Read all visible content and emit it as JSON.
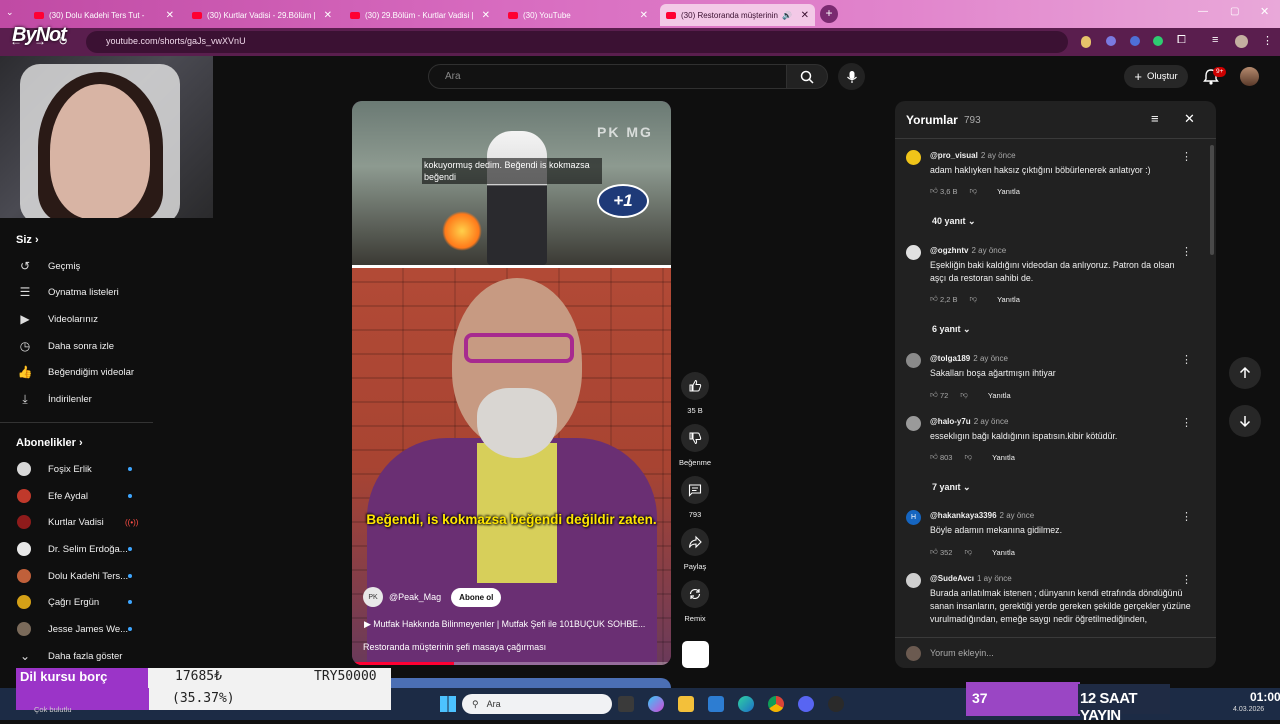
{
  "browser": {
    "tabs": [
      {
        "title": "(30) Dolu Kadehi Ters Tut -",
        "active": false
      },
      {
        "title": "(30) Kurtlar Vadisi - 29.Bölüm |",
        "active": false
      },
      {
        "title": "(30) 29.Bölüm - Kurtlar Vadisi |",
        "active": false
      },
      {
        "title": "(30) YouTube",
        "active": false
      },
      {
        "title": "(30) Restoranda müşterinin",
        "active": true
      }
    ],
    "url": "youtube.com/shorts/gaJs_vwXVnU"
  },
  "overlay": {
    "logo": "ByNot",
    "goal_label": "Dil kursu borç",
    "goal_amount": "17685₺",
    "goal_target": "TRY50000",
    "goal_percent": "(35.37%)",
    "goal_fraction": 0.3537,
    "weather": "Çok bulutlu",
    "stream_number": "37",
    "stream_label": "12 SAAT YAYIN",
    "clock": "01:00",
    "date": "4.03.2026"
  },
  "taskbar": {
    "search_placeholder": "Ara"
  },
  "sidebar": {
    "you_heading": "Siz",
    "items": [
      "Geçmiş",
      "Oynatma listeleri",
      "Videolarınız",
      "Daha sonra izle",
      "Beğendiğim videolar",
      "İndirilenler"
    ],
    "subs_heading": "Abonelikler",
    "subscriptions": [
      {
        "name": "Foşix Erlik",
        "color": "#d8d8d8"
      },
      {
        "name": "Efe Aydal",
        "color": "#c0392b"
      },
      {
        "name": "Kurtlar Vadisi",
        "color": "#8e1b1b"
      },
      {
        "name": "Dr. Selim Erdoğa...",
        "color": "#e8e8e8"
      },
      {
        "name": "Dolu Kadehi Ters...",
        "color": "#c0603a"
      },
      {
        "name": "Çağrı Ergün",
        "color": "#d4a017"
      },
      {
        "name": "Jesse James We...",
        "color": "#7a6a5a"
      }
    ],
    "show_more": "Daha fazla göster"
  },
  "header": {
    "search_placeholder": "Ara",
    "create_label": "Oluştur",
    "notif_count": "9+"
  },
  "video": {
    "caption_top": "kokuyormuş dedim. Beğendi is kokmazsa beğendi",
    "plus_badge": "+1",
    "watermark": "PK MG",
    "subtitle": "Beğendi, is kokmazsa beğendi değildir zaten.",
    "channel": "@Peak_Mag",
    "subscribe": "Abone ol",
    "song": "Mutfak Hakkında Bilinmeyenler | Mutfak Şefi ile 101BUÇUK SOHBE...",
    "title": "Restoranda müşterinin şefi masaya çağırması",
    "progress": 0.32
  },
  "actions": {
    "like_count": "35 B",
    "dislike_label": "Beğenme",
    "comment_count": "793",
    "share_label": "Paylaş",
    "remix_label": "Remix"
  },
  "comments": {
    "title": "Yorumlar",
    "count": "793",
    "placeholder": "Yorum ekleyin...",
    "items": [
      {
        "author": "@pro_visual",
        "time": "2 ay önce",
        "text": "adam haklıyken haksız çıktığını böbürlenerek anlatıyor :)",
        "likes": "3,6 B",
        "reply": "Yanıtla",
        "avatar": "#f0c419"
      },
      {
        "author": "@ogzhntv",
        "time": "2 ay önce",
        "text": "Eşekliğin baki kaldığını videodan da anlıyoruz. Patron da olsan aşçı da restoran sahibi de.",
        "likes": "2,2 B",
        "reply": "Yanıtla",
        "avatar": "#e0e0e0"
      },
      {
        "author": "@tolga189",
        "time": "2 ay önce",
        "text": "Sakalları boşa ağartmışın ihtiyar",
        "likes": "72",
        "reply": "Yanıtla",
        "avatar": "#8a8a8a"
      },
      {
        "author": "@halo-y7u",
        "time": "2 ay önce",
        "text": "esseklıgın bağı kaldığının ispatısın.kibir kötüdür.",
        "likes": "803",
        "reply": "Yanıtla",
        "avatar": "#9a9a9a"
      },
      {
        "author": "@hakankaya3396",
        "time": "2 ay önce",
        "text": "Böyle adamın mekanına gidilmez.",
        "likes": "352",
        "reply": "Yanıtla",
        "avatar": "#1565c0"
      },
      {
        "author": "@SudeAvcı",
        "time": "1 ay önce",
        "text": "Burada anlatılmak istenen ; dünyanın kendi etrafında döndüğünü sanan insanların, gerektiği yerde gereken şekilde gerçekler yüzüne vurulmadığından, emeğe saygı nedir öğretilmediğinden,",
        "likes": "",
        "reply": "",
        "avatar": "#cfcfcf"
      }
    ],
    "replies": [
      "40 yanıt",
      "6 yanıt",
      "7 yanıt"
    ]
  }
}
